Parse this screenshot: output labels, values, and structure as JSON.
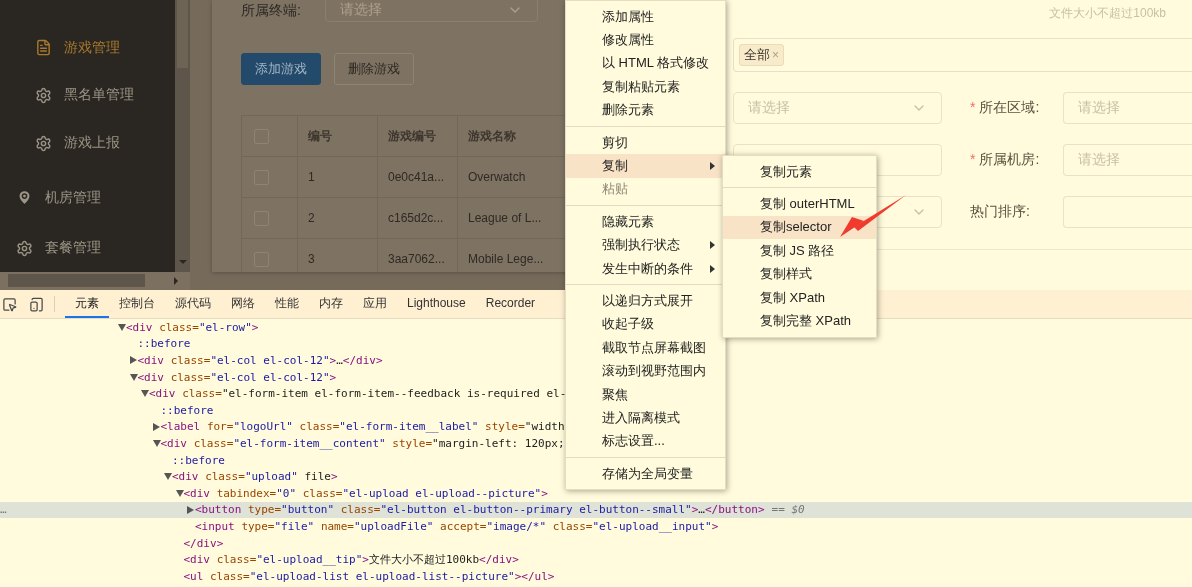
{
  "sidebar": {
    "items": [
      {
        "label": "游戏管理",
        "kind": "doc-sub",
        "selected": true
      },
      {
        "label": "黑名单管理",
        "kind": "gear-sub",
        "selected": false
      },
      {
        "label": "游戏上报",
        "kind": "gear-sub",
        "selected": false
      },
      {
        "label": "机房管理",
        "kind": "pin-top",
        "selected": false
      },
      {
        "label": "套餐管理",
        "kind": "gear-top",
        "selected": false
      }
    ]
  },
  "filter": {
    "label": "所属终端:",
    "placeholder": "请选择"
  },
  "buttons": [
    {
      "label": "添加游戏",
      "kind": "primary"
    },
    {
      "label": "删除游戏",
      "kind": "default"
    }
  ],
  "table": {
    "header_checked": false,
    "columns": [
      "编号",
      "游戏编号",
      "游戏名称"
    ],
    "rows": [
      {
        "checked": false,
        "cells": [
          "1",
          "0e0c41a...",
          "Overwatch"
        ]
      },
      {
        "checked": false,
        "cells": [
          "2",
          "c165d2c...",
          "League of L..."
        ]
      },
      {
        "checked": false,
        "cells": [
          "3",
          "3aa7062...",
          "Mobile Lege..."
        ]
      }
    ]
  },
  "dialog": {
    "tip": "文件大小不超过100kb",
    "tags": [
      {
        "label": "全部",
        "remove": "×"
      }
    ],
    "rows": [
      {
        "left": {
          "kind": "select",
          "placeholder": "请选择"
        },
        "mark": "*",
        "label": "所在区域:",
        "right": {
          "placeholder": "请选择"
        }
      },
      {
        "left": {
          "kind": "input"
        },
        "mark": "*",
        "label": "所属机房:",
        "right": {
          "placeholder": "请选择"
        }
      },
      {
        "left": {
          "kind": "select"
        },
        "label": "热门排序:",
        "right": {}
      }
    ]
  },
  "devtools": {
    "tabs": [
      {
        "label": "元素",
        "selected": true
      },
      {
        "label": "控制台",
        "selected": false
      },
      {
        "label": "源代码",
        "selected": false
      },
      {
        "label": "网络",
        "selected": false
      },
      {
        "label": "性能",
        "selected": false
      },
      {
        "label": "内存",
        "selected": false
      },
      {
        "label": "应用",
        "selected": false
      },
      {
        "label": "Lighthouse",
        "selected": false
      },
      {
        "label": "Recorder",
        "selected": false
      }
    ],
    "selected_marker": "…",
    "tree": [
      {
        "text": "<div class=\"el-row\">",
        "kind": "open",
        "selected": false,
        "children": [
          {
            "text": "::before",
            "kind": "pseudo",
            "selected": false
          },
          {
            "text": "<div class=\"el-col el-col-12\">…</div>",
            "kind": "closed",
            "selected": false
          },
          {
            "text": "<div class=\"el-col el-col-12\">",
            "kind": "open",
            "selected": false,
            "children": [
              {
                "text": "<div class=\"el-form-item el-form-item--feedback is-required el-",
                "kind": "open",
                "selected": false,
                "children": [
                  {
                    "text": "::before",
                    "kind": "pseudo",
                    "selected": false
                  },
                  {
                    "text": "<label for=\"logoUrl\" class=\"el-form-item__label\" style=\"width",
                    "kind": "closed",
                    "selected": false
                  },
                  {
                    "text": "<div class=\"el-form-item__content\" style=\"margin-left: 120px;",
                    "kind": "open",
                    "selected": false,
                    "children": [
                      {
                        "text": "::before",
                        "kind": "pseudo",
                        "selected": false
                      },
                      {
                        "text": "<div class=\"upload\" file>",
                        "kind": "open",
                        "selected": false,
                        "children": [
                          {
                            "text": "<div tabindex=\"0\" class=\"el-upload el-upload--picture\">",
                            "kind": "open",
                            "selected": false,
                            "children": [
                              {
                                "text": "<button type=\"button\" class=\"el-button el-button--primary el-button--small\">…</button>",
                                "suffix": "== $0",
                                "kind": "closed",
                                "selected": true
                              },
                              {
                                "text": "<input type=\"file\" name=\"uploadFile\" accept=\"image/*\" class=\"el-upload__input\">",
                                "kind": "leaf",
                                "selected": false
                              }
                            ]
                          },
                          {
                            "text": "</div>",
                            "kind": "leaf",
                            "selected": false
                          },
                          {
                            "text": "<div class=\"el-upload__tip\">文件大小不超过100kb</div>",
                            "kind": "leaf",
                            "selected": false
                          },
                          {
                            "text": "<ul class=\"el-upload-list el-upload-list--picture\"></ul>",
                            "kind": "leaf",
                            "selected": false
                          }
                        ]
                      }
                    ]
                  }
                ]
              }
            ]
          }
        ]
      }
    ]
  },
  "context_menu": {
    "items": [
      {
        "kind": "item",
        "label": "添加属性",
        "disabled": false,
        "selected": false,
        "submenu": false
      },
      {
        "kind": "item",
        "label": "修改属性",
        "disabled": false,
        "selected": false,
        "submenu": false
      },
      {
        "kind": "item",
        "label": "以 HTML 格式修改",
        "disabled": false,
        "selected": false,
        "submenu": false
      },
      {
        "kind": "item",
        "label": "复制粘贴元素",
        "disabled": false,
        "selected": false,
        "submenu": false
      },
      {
        "kind": "item",
        "label": "删除元素",
        "disabled": false,
        "selected": false,
        "submenu": false
      },
      {
        "kind": "separator"
      },
      {
        "kind": "item",
        "label": "剪切",
        "disabled": false,
        "selected": false,
        "submenu": false
      },
      {
        "kind": "item",
        "label": "复制",
        "disabled": false,
        "selected": true,
        "submenu": true
      },
      {
        "kind": "item",
        "label": "粘贴",
        "disabled": true,
        "selected": false,
        "submenu": false
      },
      {
        "kind": "separator"
      },
      {
        "kind": "item",
        "label": "隐藏元素",
        "disabled": false,
        "selected": false,
        "submenu": false
      },
      {
        "kind": "item",
        "label": "强制执行状态",
        "disabled": false,
        "selected": false,
        "submenu": true
      },
      {
        "kind": "item",
        "label": "发生中断的条件",
        "disabled": false,
        "selected": false,
        "submenu": true
      },
      {
        "kind": "separator"
      },
      {
        "kind": "item",
        "label": "以递归方式展开",
        "disabled": false,
        "selected": false,
        "submenu": false
      },
      {
        "kind": "item",
        "label": "收起子级",
        "disabled": false,
        "selected": false,
        "submenu": false
      },
      {
        "kind": "item",
        "label": "截取节点屏幕截图",
        "disabled": false,
        "selected": false,
        "submenu": false
      },
      {
        "kind": "item",
        "label": "滚动到视野范围内",
        "disabled": false,
        "selected": false,
        "submenu": false
      },
      {
        "kind": "item",
        "label": "聚焦",
        "disabled": false,
        "selected": false,
        "submenu": false
      },
      {
        "kind": "item",
        "label": "进入隔离模式",
        "disabled": false,
        "selected": false,
        "submenu": false
      },
      {
        "kind": "item",
        "label": "标志设置...",
        "disabled": false,
        "selected": false,
        "submenu": false
      },
      {
        "kind": "separator"
      },
      {
        "kind": "item",
        "label": "存储为全局变量",
        "disabled": false,
        "selected": false,
        "submenu": false
      }
    ]
  },
  "submenu": {
    "items": [
      {
        "kind": "item",
        "label": "复制元素",
        "disabled": false,
        "selected": false,
        "submenu": false
      },
      {
        "kind": "separator"
      },
      {
        "kind": "item",
        "label": "复制 outerHTML",
        "disabled": false,
        "selected": false,
        "submenu": false
      },
      {
        "kind": "item",
        "label": "复制selector",
        "disabled": false,
        "selected": true,
        "submenu": false
      },
      {
        "kind": "item",
        "label": "复制 JS 路径",
        "disabled": false,
        "selected": false,
        "submenu": false
      },
      {
        "kind": "item",
        "label": "复制样式",
        "disabled": false,
        "selected": false,
        "submenu": false
      },
      {
        "kind": "item",
        "label": "复制 XPath",
        "disabled": false,
        "selected": false,
        "submenu": false
      },
      {
        "kind": "item",
        "label": "复制完整 XPath",
        "disabled": false,
        "selected": false,
        "submenu": false
      }
    ]
  }
}
